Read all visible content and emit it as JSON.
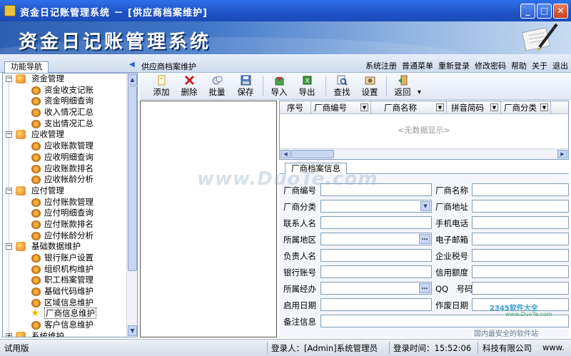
{
  "window": {
    "title": "资金日记账管理系统 － [供应商档案维护]",
    "minimize_glyph": "_",
    "maximize_glyph": "□",
    "close_glyph": "✕"
  },
  "banner": {
    "app_title": "资金日记账管理系统"
  },
  "strip": {
    "nav_tab_label": "功能导航",
    "collapse_glyph": "◀",
    "page_crumb": "供应商档案维护",
    "menu": [
      "系统注册",
      "普通菜单",
      "重新登录",
      "修改密码",
      "帮助",
      "关于",
      "退出"
    ]
  },
  "tree": [
    {
      "label": "资金管理",
      "expanded_glyph": "−",
      "items": [
        "资金收支记账",
        "资金明细查询",
        "收入情况汇总",
        "支出情况汇总"
      ]
    },
    {
      "label": "应收管理",
      "expanded_glyph": "−",
      "items": [
        "应收账款管理",
        "应收明细查询",
        "应收账款排名",
        "应收帐龄分析"
      ]
    },
    {
      "label": "应付管理",
      "expanded_glyph": "−",
      "items": [
        "应付账款管理",
        "应付明细查询",
        "应付账款排名",
        "应付帐龄分析"
      ]
    },
    {
      "label": "基础数据维护",
      "expanded_glyph": "−",
      "items": [
        "银行账户设置",
        "组织机构维护",
        "职工档案管理",
        "基础代码维护",
        "区域信息维护",
        "厂商信息维护",
        "客户信息维护"
      ]
    },
    {
      "label": "系统维护",
      "expanded_glyph": "+",
      "items": []
    }
  ],
  "tree_selected": "厂商信息维护",
  "toolbar": {
    "buttons": [
      {
        "label": "添加",
        "icon": "page-add-icon"
      },
      {
        "label": "删除",
        "icon": "delete-x-icon"
      },
      {
        "label": "批量",
        "icon": "batch-icon"
      },
      {
        "label": "保存",
        "icon": "save-disk-icon"
      },
      {
        "label": "导入",
        "icon": "import-icon"
      },
      {
        "label": "导出",
        "icon": "export-icon"
      },
      {
        "label": "查找",
        "icon": "find-icon"
      },
      {
        "label": "设置",
        "icon": "settings-icon"
      },
      {
        "label": "返回",
        "icon": "return-icon"
      }
    ],
    "more_glyph": "▾"
  },
  "grid": {
    "columns": [
      "序号",
      "厂商编号",
      "厂商名称",
      "拼音简码",
      "厂商分类"
    ],
    "empty_text": "<无数据显示>"
  },
  "detail": {
    "tab_label": "厂商档案信息",
    "rows": [
      {
        "left": {
          "label": "厂商编号",
          "kind": "text"
        },
        "right": {
          "label": "厂商名称",
          "kind": "text"
        }
      },
      {
        "left": {
          "label": "厂商分类",
          "kind": "select"
        },
        "right": {
          "label": "厂商地址",
          "kind": "text"
        }
      },
      {
        "left": {
          "label": "联系人名",
          "kind": "text"
        },
        "right": {
          "label": "手机电话",
          "kind": "text"
        }
      },
      {
        "left": {
          "label": "所属地区",
          "kind": "lookup"
        },
        "right": {
          "label": "电子邮箱",
          "kind": "text"
        }
      },
      {
        "left": {
          "label": "负责人名",
          "kind": "text"
        },
        "right": {
          "label": "企业税号",
          "kind": "text"
        }
      },
      {
        "left": {
          "label": "银行账号",
          "kind": "text"
        },
        "right": {
          "label": "信用额度",
          "kind": "text"
        }
      },
      {
        "left": {
          "label": "所属经办",
          "kind": "lookup"
        },
        "right": {
          "label": "QQ　号码",
          "kind": "text"
        }
      },
      {
        "left": {
          "label": "启用日期",
          "kind": "text"
        },
        "right": {
          "label": "作废日期",
          "kind": "text"
        }
      },
      {
        "left": {
          "label": "备注信息",
          "kind": "wide"
        },
        "right": null
      }
    ]
  },
  "watermarks": {
    "main": "www.DuoTe.com",
    "logo": "2345软件大全",
    "url": "www.DuoTe.com",
    "slogan": "国内最安全的软件站"
  },
  "status": {
    "edition": "试用版",
    "login_user": "登录人：[Admin]系统管理员",
    "login_time": "登录时间：15:52:06",
    "company": "科技有限公司",
    "site": "www."
  }
}
